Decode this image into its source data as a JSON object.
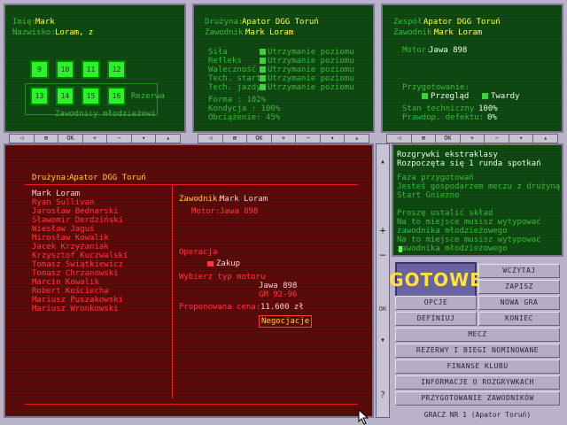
{
  "top_left": {
    "imie_label": "Imię:",
    "imie": "Mark",
    "nazwisko_label": "Nazwisko:",
    "nazwisko": "Loram, z",
    "squares_top": [
      "9",
      "10",
      "11",
      "12"
    ],
    "squares_bottom": [
      "13",
      "14",
      "15",
      "16"
    ],
    "rezerwa": "Rezerwa",
    "mlodziezowi": "Zawodnicy młodzieżowi"
  },
  "top_mid": {
    "druzyna_label": "Drużyna:",
    "druzyna": "Apator DGG Toruń",
    "zawodnik_label": "Zawodnik:",
    "zawodnik": "Mark Loram",
    "stats": [
      {
        "label": "Siła",
        "value": "Utrzymanie poziomu"
      },
      {
        "label": "Refleks",
        "value": "Utrzymanie poziomu"
      },
      {
        "label": "Waleczność",
        "value": "Utrzymanie poziomu"
      },
      {
        "label": "Tech. startu",
        "value": "Utrzymanie poziomu"
      },
      {
        "label": "Tech. jazdy",
        "value": "Utrzymanie poziomu"
      }
    ],
    "forma": "Forma    : 102%",
    "kondycja": "Kondycja : 100%",
    "obciazenie": "Obciążenie: 45%"
  },
  "top_right": {
    "zespol_label": "Zespół:",
    "zespol": "Apator DGG Toruń",
    "zawodnik_label": "Zawodnik:",
    "zawodnik": "Mark Loram",
    "motor_label": "Motor:",
    "motor": "Jawa 898",
    "przygotowanie": "Przygotowanie:",
    "przeglad": "Przegląd",
    "twardy": "Twardy",
    "stan_label": "Stan techniczny :",
    "stan": "100%",
    "prawdop_label": "Prawdop. defektu:",
    "prawdop": "0%"
  },
  "controls": [
    "◁",
    "⊞",
    "OK",
    "+",
    "−",
    "▾",
    "▴"
  ],
  "main": {
    "druzyna_label": "Drużyna:",
    "druzyna": "Apator DGG Toruń",
    "riders": [
      "Mark Loram",
      "Ryan Sullivan",
      "Jarosław Bednarski",
      "Sławomir Derdziński",
      "Wiesław Jaguś",
      "Mirosław Kowalik",
      "Jacek Krzyżaniak",
      "Krzysztof Kuczwalski",
      "Tomasz Świątkiewicz",
      "Tomasz Chrzanowski",
      "Marcin Kowalik",
      "Robert Kościecha",
      "Mariusz Puszakowski",
      "Mariusz Wronkowski"
    ],
    "zawodnik_label": "Zawodnik:",
    "zawodnik": "Mark Loram",
    "motor_label": "Motor:",
    "motor": "Jawa 898",
    "operacja": "Operacja",
    "zakup": "Zakup",
    "wybierz": "Wybierz typ motoru",
    "typ1": "Jawa 898",
    "typ2": "GM 92-96",
    "cena_label": "Proponowana cena:",
    "cena": "11.600 zł",
    "negocjacje": "Negocjacje"
  },
  "scroll": {
    "up": "▴",
    "plus": "+",
    "minus": "−",
    "ok": "OK",
    "down": "▾",
    "help": "?"
  },
  "log": {
    "lines_bright": [
      "Rozgrywki ekstraklasy",
      "Rozpoczęta się 1 runda spotkań"
    ],
    "lines": [
      "Faza przygotowań",
      "Jesteś gospodarzem meczu z drużyną",
      "Start Gniezno",
      "",
      "Proszę ustalić skład",
      "Na to miejsce musisz wytypować",
      "zawodnika młodzieżowego",
      "Na to miejsce musisz wytypować",
      "zawodnika młodzieżowego"
    ]
  },
  "menu": {
    "gotowe": "GOTOWE",
    "wczytaj": "WCZYTAJ",
    "zapisz": "ZAPISZ",
    "opcje": "OPCJE",
    "nowa_gra": "NOWA GRA",
    "definiuj": "DEFINIUJ",
    "koniec": "KONIEC",
    "mecz": "MECZ",
    "rezerwy": "REZERWY I BIEGI NOMINOWANE",
    "finanse": "FINANSE KLUBU",
    "informacje": "INFORMACJE O ROZGRYWKACH",
    "przygotowanie": "PRZYGOTOWANIE ZAWODNIKÓW"
  },
  "status": "GRACZ NR 1  (Apator Toruń)"
}
